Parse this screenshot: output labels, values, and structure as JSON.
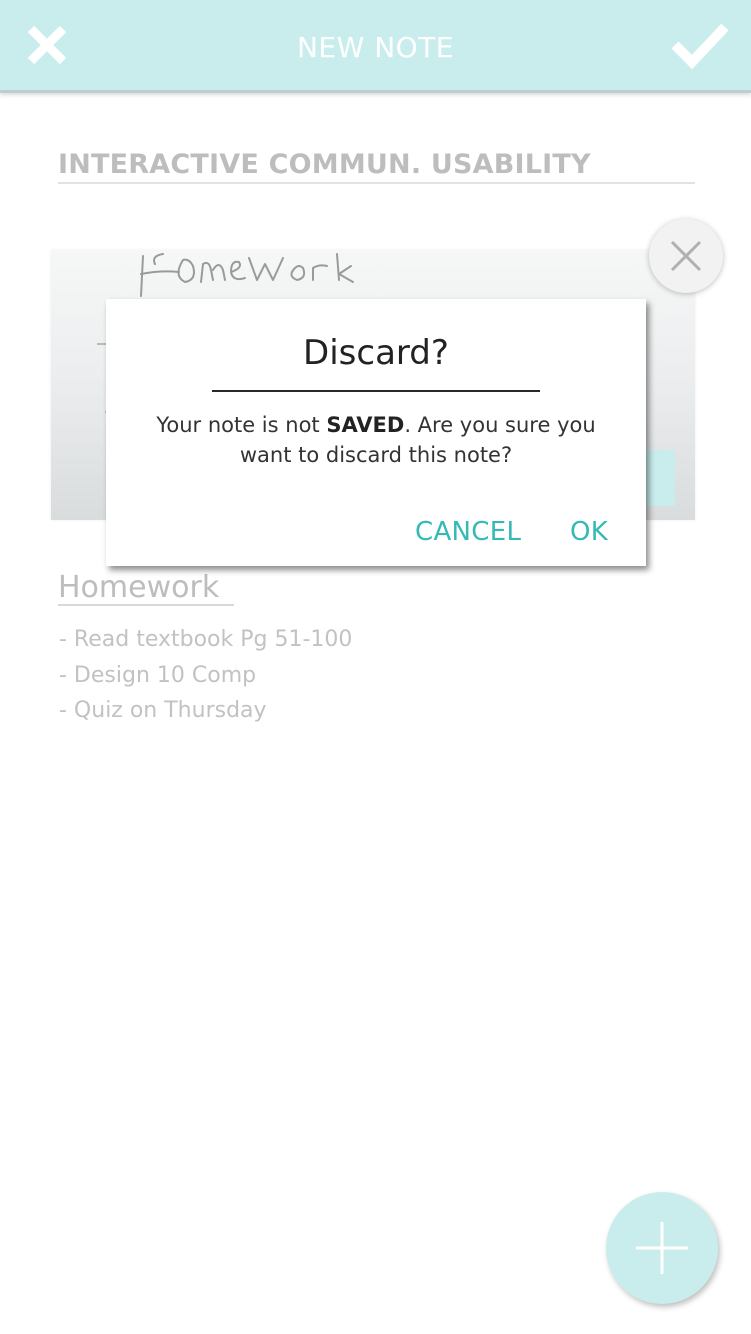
{
  "header": {
    "title": "NEW NOTE",
    "close_icon": "close-icon",
    "save_icon": "check-icon",
    "background_color": "#c9eded"
  },
  "note": {
    "title": "INTERACTIVE COMMUN. USABILITY",
    "attachment": {
      "kind": "handwriting image",
      "remove_icon": "close-icon"
    },
    "heading": "Homework",
    "lines": [
      "- Read textbook Pg 51-100",
      "- Design 10 Comp",
      "- Quiz on Thursday"
    ]
  },
  "dialog": {
    "title": "Discard?",
    "message_before": "Your note is not ",
    "message_emphasis": "SAVED",
    "message_after": ". Are you sure you want to discard this note?",
    "cancel_label": "CANCEL",
    "ok_label": "OK",
    "accent_color": "#35b9b5"
  },
  "fab": {
    "icon": "plus-icon"
  }
}
